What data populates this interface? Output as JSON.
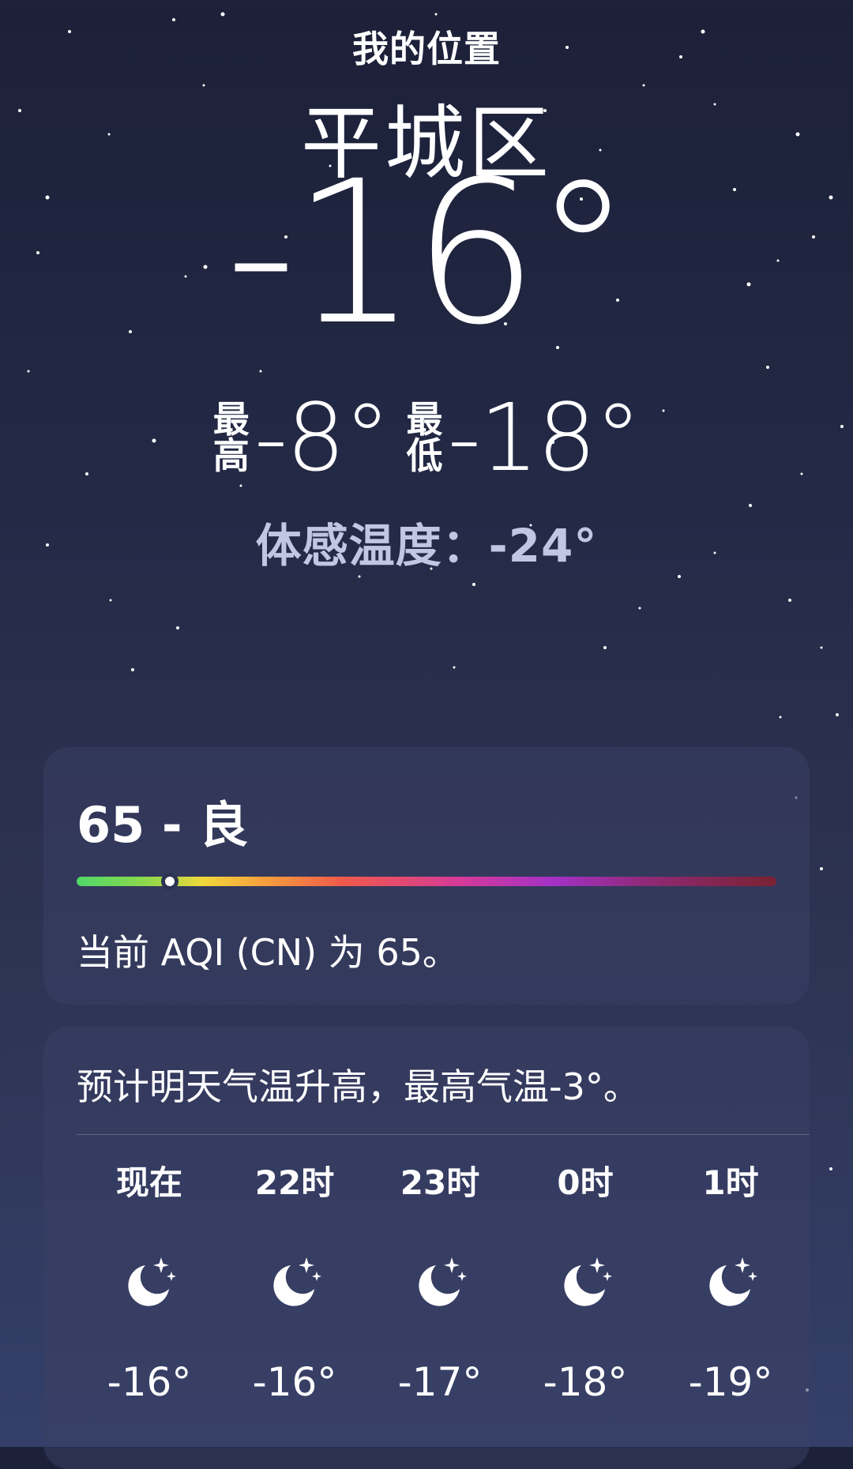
{
  "header": {
    "location_label": "我的位置",
    "city": "平城区",
    "current_temp": "-16°",
    "high_label_top": "最",
    "high_label_bottom": "高",
    "high": "-8°",
    "low_label_top": "最",
    "low_label_bottom": "低",
    "low": "-18°",
    "feels_like": "体感温度：-24°"
  },
  "aqi": {
    "value_text": "65 - 良",
    "level": 0.133,
    "description": "当前 AQI (CN) 为 65。"
  },
  "forecast": {
    "summary": "预计明天气温升高，最高气温-3°。",
    "hours": [
      {
        "time": "现在",
        "icon": "moon-stars-icon",
        "temp": "-16°"
      },
      {
        "time": "22时",
        "icon": "moon-stars-icon",
        "temp": "-16°"
      },
      {
        "time": "23时",
        "icon": "moon-stars-icon",
        "temp": "-17°"
      },
      {
        "time": "0时",
        "icon": "moon-stars-icon",
        "temp": "-18°"
      },
      {
        "time": "1时",
        "icon": "moon-stars-icon",
        "temp": "-19°"
      }
    ]
  },
  "colors": {
    "background_top": "#1c2038",
    "background_bottom": "#34406a",
    "feels_like_text": "#c2c6e0"
  }
}
